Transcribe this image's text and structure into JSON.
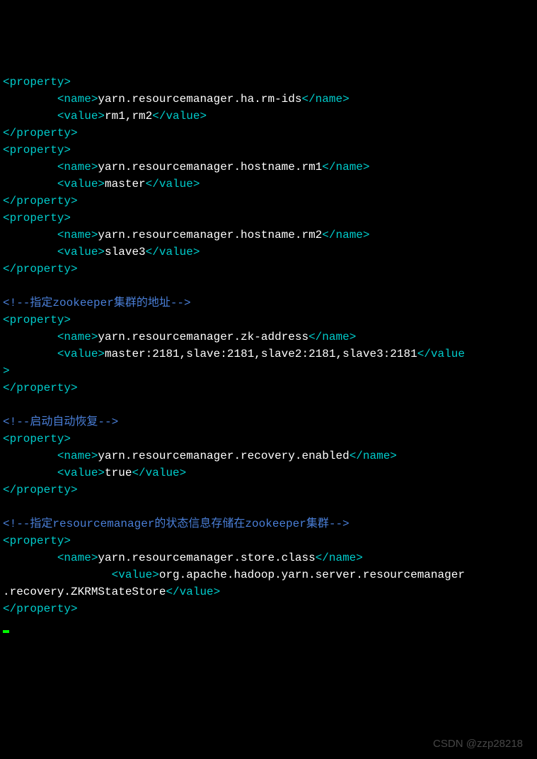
{
  "tags": {
    "property_open": "<property>",
    "property_close": "</property>",
    "name_open": "<name>",
    "name_close": "</name>",
    "value_open": "<value>",
    "value_close": "</value>"
  },
  "properties": [
    {
      "name": "yarn.resourcemanager.ha.rm-ids",
      "value": "rm1,rm2"
    },
    {
      "name": "yarn.resourcemanager.hostname.rm1",
      "value": "master"
    },
    {
      "name": "yarn.resourcemanager.hostname.rm2",
      "value": "slave3"
    }
  ],
  "comment_zk": "<!--指定zookeeper集群的地址-->",
  "prop_zk": {
    "name": "yarn.resourcemanager.zk-address",
    "value": "master:2181,slave:2181,slave2:2181,slave3:2181"
  },
  "value_close_wrap": ">",
  "comment_recovery": "<!--启动自动恢复-->",
  "prop_recovery": {
    "name": "yarn.resourcemanager.recovery.enabled",
    "value": "true"
  },
  "comment_store": "<!--指定resourcemanager的状态信息存储在zookeeper集群-->",
  "prop_store": {
    "name": "yarn.resourcemanager.store.class",
    "value_part1": "org.apache.hadoop.yarn.server.resourcemanager",
    "value_part2": ".recovery.ZKRMStateStore"
  },
  "watermark": "CSDN @zzp28218"
}
